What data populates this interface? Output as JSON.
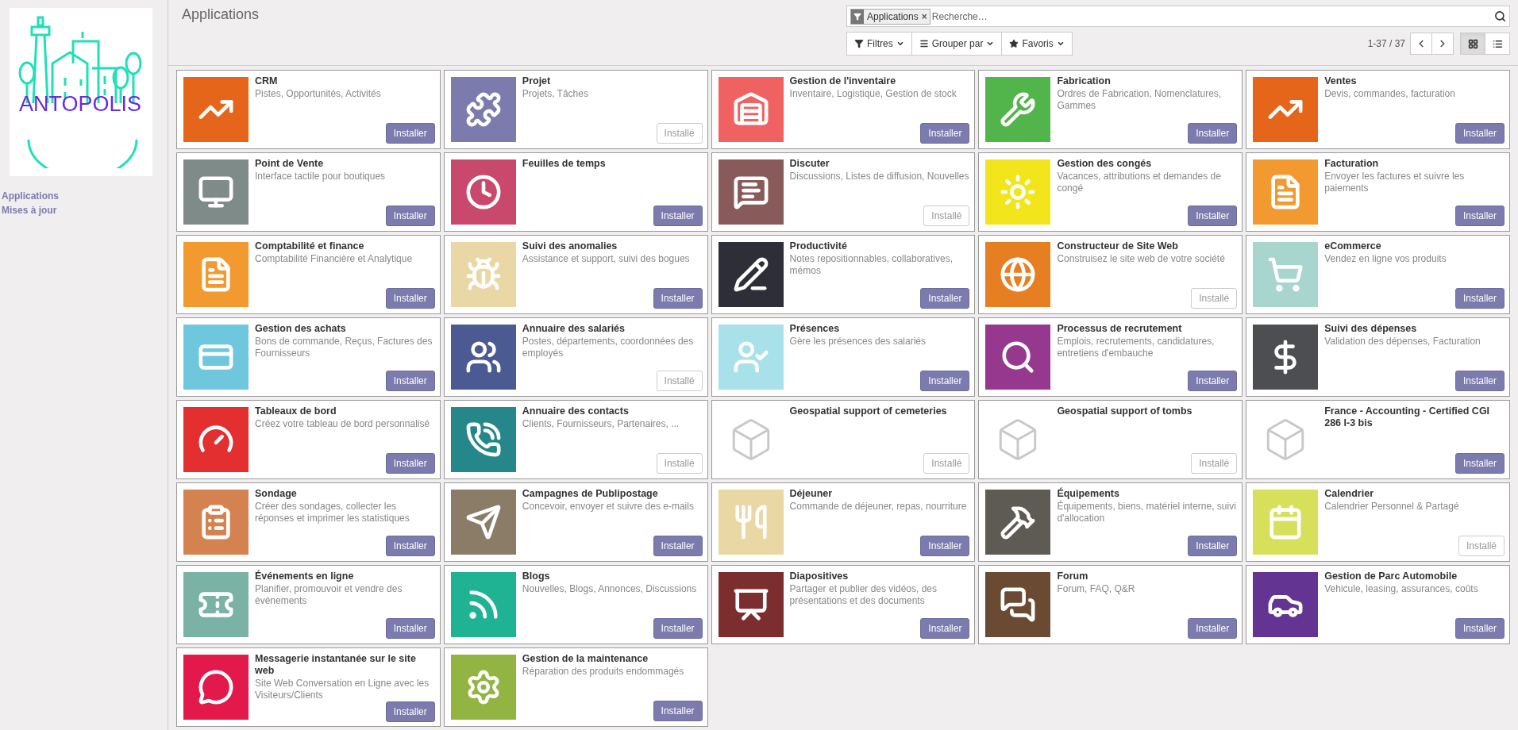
{
  "sidebar": {
    "logo_text": "ANTOPOLIS",
    "items": [
      {
        "label": "Applications"
      },
      {
        "label": "Mises à jour"
      }
    ]
  },
  "header": {
    "title": "Applications",
    "search": {
      "facet": "Applications",
      "facet_remove": "×",
      "placeholder": "Recherche…"
    },
    "buttons": [
      {
        "label": "Filtres",
        "kind": "filter"
      },
      {
        "label": "Grouper par",
        "kind": "group"
      },
      {
        "label": "Favoris",
        "kind": "favorite"
      }
    ],
    "pager": "1-37 / 37",
    "views": [
      {
        "kind": "kanban",
        "selected": true
      },
      {
        "kind": "list",
        "selected": false
      }
    ]
  },
  "apps": [
    {
      "title": "CRM",
      "summary": "Pistes, Opportunités, Activités",
      "color": "#e5661a",
      "button": "Installer",
      "installed": false
    },
    {
      "title": "Projet",
      "summary": "Projets, Tâches",
      "color": "#7c7bad",
      "button": "Installé",
      "installed": true
    },
    {
      "title": "Gestion de l'inventaire",
      "summary": "Inventaire, Logistique, Gestion de stock",
      "color": "#f06262",
      "button": "Installer",
      "installed": false
    },
    {
      "title": "Fabrication",
      "summary": "Ordres de Fabrication, Nomenclatures, Gammes",
      "color": "#52b54b",
      "button": "Installer",
      "installed": false
    },
    {
      "title": "Ventes",
      "summary": "Devis, commandes, facturation",
      "color": "#e5661a",
      "button": "Installer",
      "installed": false
    },
    {
      "title": "Point de Vente",
      "summary": "Interface tactile pour boutiques",
      "color": "#7f8b89",
      "button": "Installer",
      "installed": false
    },
    {
      "title": "Feuilles de temps",
      "color": "#c9496c",
      "button": "Installer",
      "installed": false
    },
    {
      "title": "Discuter",
      "summary": "Discussions, Listes de diffusion, Nouvelles",
      "color": "#885a5a",
      "button": "Installé",
      "installed": true
    },
    {
      "title": "Gestion des congés",
      "summary": "Vacances, attributions et demandes de congé",
      "color": "#f2e51c",
      "button": "Installer",
      "installed": false
    },
    {
      "title": "Facturation",
      "summary": "Envoyer les factures et suivre les paiements",
      "color": "#f2992f",
      "button": "Installer",
      "installed": false
    },
    {
      "title": "Comptabilité et finance",
      "summary": "Comptabilité Financière et Analytique",
      "color": "#f2992f",
      "button": "Installer",
      "installed": false
    },
    {
      "title": "Suivi des anomalies",
      "summary": "Assistance et support, suivi des bogues",
      "color": "#e9d8a6",
      "button": "Installer",
      "installed": false
    },
    {
      "title": "Productivité",
      "summary": "Notes repositionnables, collaboratives, mémos",
      "color": "#2d2e38",
      "button": "Installer",
      "installed": false
    },
    {
      "title": "Constructeur de Site Web",
      "summary": "Construisez le site web de votre société",
      "color": "#e67e22",
      "button": "Installé",
      "installed": true
    },
    {
      "title": "eCommerce",
      "summary": "Vendez en ligne vos produits",
      "color": "#a8d6cf",
      "button": "Installer",
      "installed": false
    },
    {
      "title": "Gestion des achats",
      "summary": "Bons de commande, Reçus, Factures des Fournisseurs",
      "color": "#6ec7dc",
      "button": "Installer",
      "installed": false
    },
    {
      "title": "Annuaire des salariés",
      "summary": "Postes, départements, coordonnées des employés",
      "color": "#4b5a92",
      "button": "Installé",
      "installed": true
    },
    {
      "title": "Présences",
      "summary": "Gère les présences des salariés",
      "color": "#a9e1eb",
      "button": "Installer",
      "installed": false
    },
    {
      "title": "Processus de recrutement",
      "summary": "Emplois, recrutements, candidatures, entretiens d'embauche",
      "color": "#97388f",
      "button": "Installer",
      "installed": false
    },
    {
      "title": "Suivi des dépenses",
      "summary": "Validation des dépenses, Facturation",
      "color": "#4c4e51",
      "button": "Installer",
      "installed": false
    },
    {
      "title": "Tableaux de bord",
      "summary": "Créez votre tableau de bord personnalisé",
      "color": "#e32f2f",
      "button": "Installer",
      "installed": false
    },
    {
      "title": "Annuaire des contacts",
      "summary": "Clients, Fournisseurs, Partenaires, ...",
      "color": "#26878a",
      "button": "Installé",
      "installed": true
    },
    {
      "title": "Geospatial support of cemeteries",
      "color": "#ffffff",
      "button": "Installé",
      "installed": true
    },
    {
      "title": "Geospatial support of tombs",
      "color": "#ffffff",
      "button": "Installé",
      "installed": true
    },
    {
      "title": "France - Accounting - Certified CGI 286 I-3 bis",
      "color": "#ffffff",
      "button": "Installer",
      "installed": false
    },
    {
      "title": "Sondage",
      "summary": "Créer des sondages, collecter les réponses et imprimer les statistiques",
      "color": "#d4824f",
      "button": "Installer",
      "installed": false
    },
    {
      "title": "Campagnes de Publipostage",
      "summary": "Concevoir, envoyer et suivre des e-mails",
      "color": "#8b7c68",
      "button": "Installer",
      "installed": false
    },
    {
      "title": "Déjeuner",
      "summary": "Commande de déjeuner, repas, nourriture",
      "color": "#e9d7a4",
      "button": "Installer",
      "installed": false
    },
    {
      "title": "Équipements",
      "summary": "Équipements, biens, matériel interne, suivi d'allocation",
      "color": "#5e5a54",
      "button": "Installer",
      "installed": false
    },
    {
      "title": "Calendrier",
      "summary": "Calendrier Personnel & Partagé",
      "color": "#d7e05b",
      "button": "Installé",
      "installed": true
    },
    {
      "title": "Événements en ligne",
      "summary": "Planifier, promouvoir et vendre des événements",
      "color": "#7ab3a6",
      "button": "Installer",
      "installed": false
    },
    {
      "title": "Blogs",
      "summary": "Nouvelles, Blogs, Annonces, Discussions",
      "color": "#1fb393",
      "button": "Installer",
      "installed": false
    },
    {
      "title": "Diapositives",
      "summary": "Partager et publier des vidéos, des présentations et des documents",
      "color": "#7c2e2e",
      "button": "Installer",
      "installed": false
    },
    {
      "title": "Forum",
      "summary": "Forum, FAQ, Q&R",
      "color": "#6b4a33",
      "button": "Installer",
      "installed": false
    },
    {
      "title": "Gestion de Parc Automobile",
      "summary": "Vehicule, leasing, assurances, coûts",
      "color": "#633491",
      "button": "Installer",
      "installed": false
    },
    {
      "title": "Messagerie instantanée sur le site web",
      "summary": "Site Web Conversation en Ligne avec les Visiteurs/Clients",
      "color": "#e3194b",
      "button": "Installer",
      "installed": false
    },
    {
      "title": "Gestion de la maintenance",
      "summary": "Réparation des produits endommagés",
      "color": "#92b443",
      "button": "Installer",
      "installed": false
    }
  ]
}
